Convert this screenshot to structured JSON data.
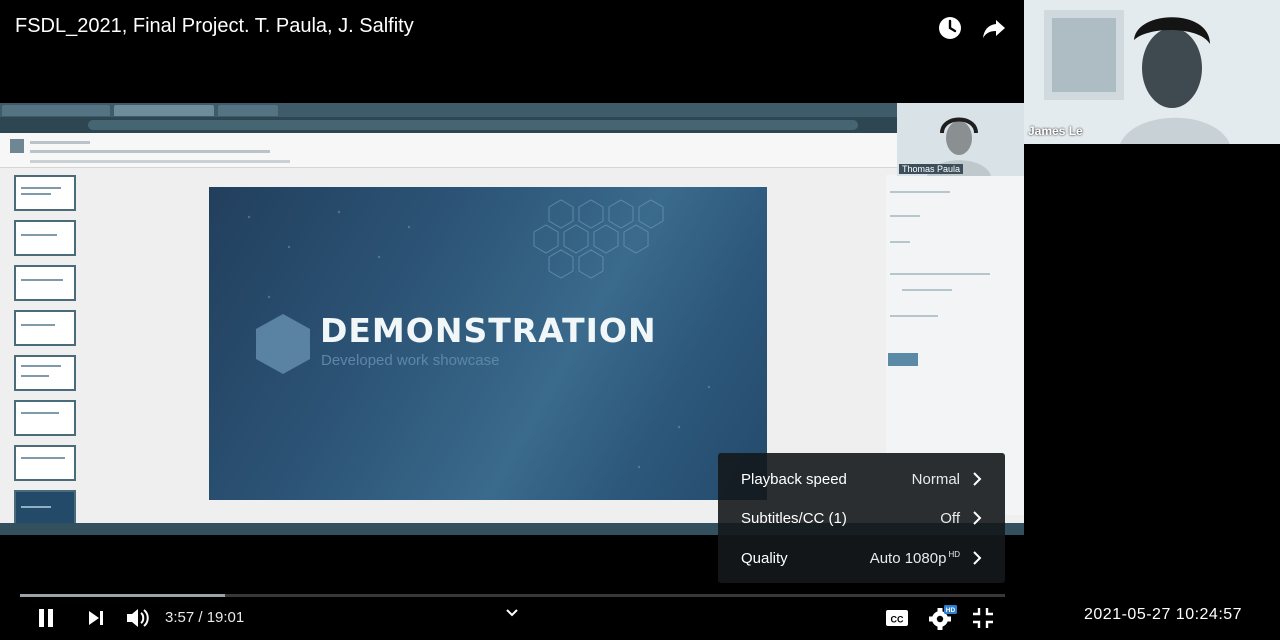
{
  "player": {
    "title": "FSDL_2021, Final Project. T. Paula, J. Salfity",
    "time_current": "3:57",
    "time_total": "19:01",
    "time_display": "3:57 / 19:01",
    "progress_fraction": 0.208,
    "controls": {
      "play_state": "playing",
      "icons": [
        "pause-icon",
        "next-icon",
        "volume-icon",
        "chevron-down-icon",
        "captions-icon",
        "settings-icon",
        "exit-fullscreen-icon",
        "watch-later-icon",
        "share-icon"
      ]
    }
  },
  "settings_menu": {
    "items": [
      {
        "label": "Playback speed",
        "value": "Normal"
      },
      {
        "label": "Subtitles/CC (1)",
        "value": "Off"
      },
      {
        "label": "Quality",
        "value": "Auto 1080p",
        "badge": "HD"
      }
    ],
    "settings_badge": "HD"
  },
  "participants": {
    "small_tile_name": "Thomas Paula",
    "big_tile_name": "James Le"
  },
  "slide": {
    "title": "DEMONSTRATION",
    "subtitle": "Developed work showcase"
  },
  "clock": "2021-05-27  10:24:57",
  "colors": {
    "background": "#000000",
    "menu_bg": "#14181c",
    "slide_accent": "#2c5476"
  }
}
